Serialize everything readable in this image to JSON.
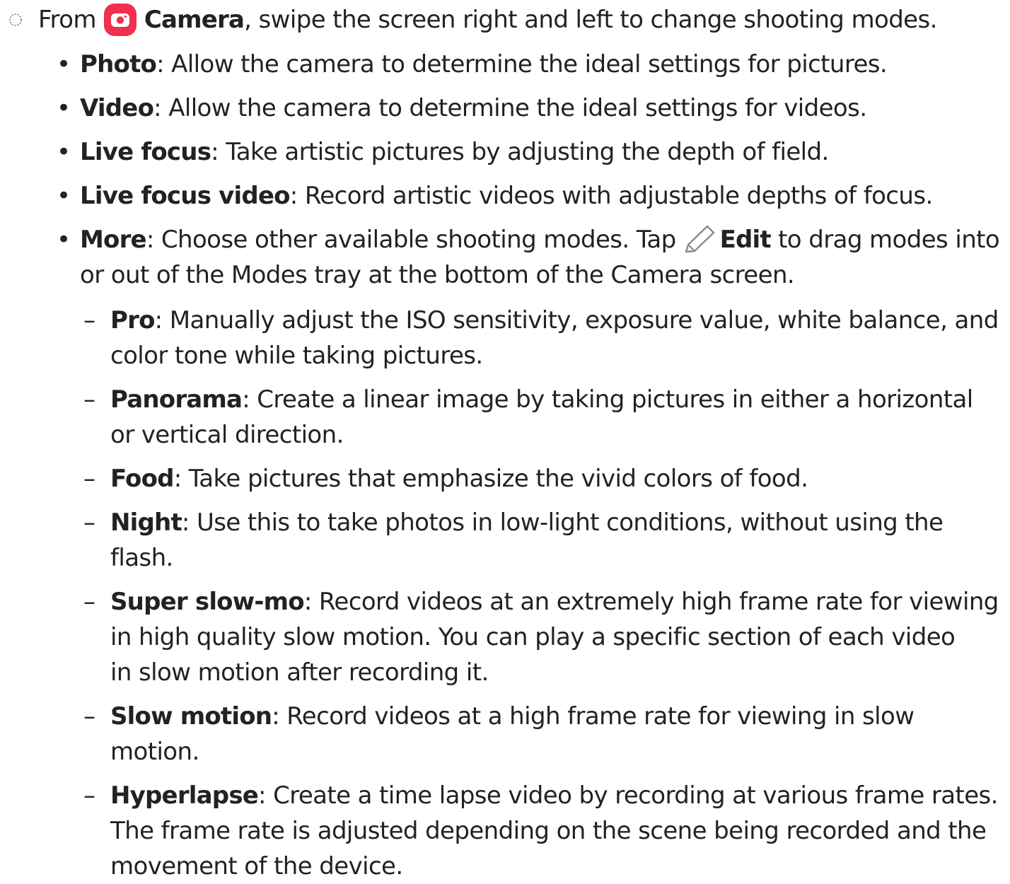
{
  "intro": {
    "before": "From",
    "app": "Camera",
    "after": ", swipe the screen right and left to change shooting modes."
  },
  "modes": [
    {
      "term": "Photo",
      "desc": ": Allow the camera to determine the ideal settings for pictures."
    },
    {
      "term": "Video",
      "desc": ": Allow the camera to determine the ideal settings for videos."
    },
    {
      "term": "Live focus",
      "desc": ": Take artistic pictures by adjusting the depth of field."
    },
    {
      "term": "Live focus video",
      "desc": ": Record artistic videos with adjustable depths of focus."
    },
    {
      "term": "More",
      "desc": ": Choose other available shooting modes. Tap",
      "edit": "Edit",
      "desc2": "to drag modes into",
      "desc3": "or out of the Modes tray at the bottom of the Camera screen."
    }
  ],
  "more_modes": [
    {
      "term": "Pro",
      "line1": ": Manually adjust the ISO sensitivity, exposure value, white balance, and",
      "line2": "color tone while taking pictures."
    },
    {
      "term": "Panorama",
      "line1": ": Create a linear image by taking pictures in either a horizontal",
      "line2": "or vertical direction."
    },
    {
      "term": "Food",
      "line1": ": Take pictures that emphasize the vivid colors of food."
    },
    {
      "term": "Night",
      "line1": ": Use this to take photos in low-light conditions, without using the",
      "line2": "flash."
    },
    {
      "term": "Super slow-mo",
      "line1": ": Record videos at an extremely high frame rate for viewing",
      "line2": "in high quality slow motion. You can play a specific section of each video",
      "line3": "in slow motion after recording it."
    },
    {
      "term": "Slow motion",
      "line1": ": Record videos at a high frame rate for viewing in slow",
      "line2": "motion."
    },
    {
      "term": "Hyperlapse",
      "line1": ": Create a time lapse video by recording at various frame rates.",
      "line2": "The frame rate is adjusted depending on the scene being recorded and the",
      "line3": "movement of the device."
    }
  ],
  "markers": {
    "bullet": "•",
    "dash": "–"
  },
  "colors": {
    "text": "#222222",
    "camera_icon": "#f0304f",
    "edit_icon": "#8a8a8a"
  },
  "icons": {
    "step": "step-circle-icon",
    "camera": "camera-app-icon",
    "edit": "pencil-icon"
  }
}
